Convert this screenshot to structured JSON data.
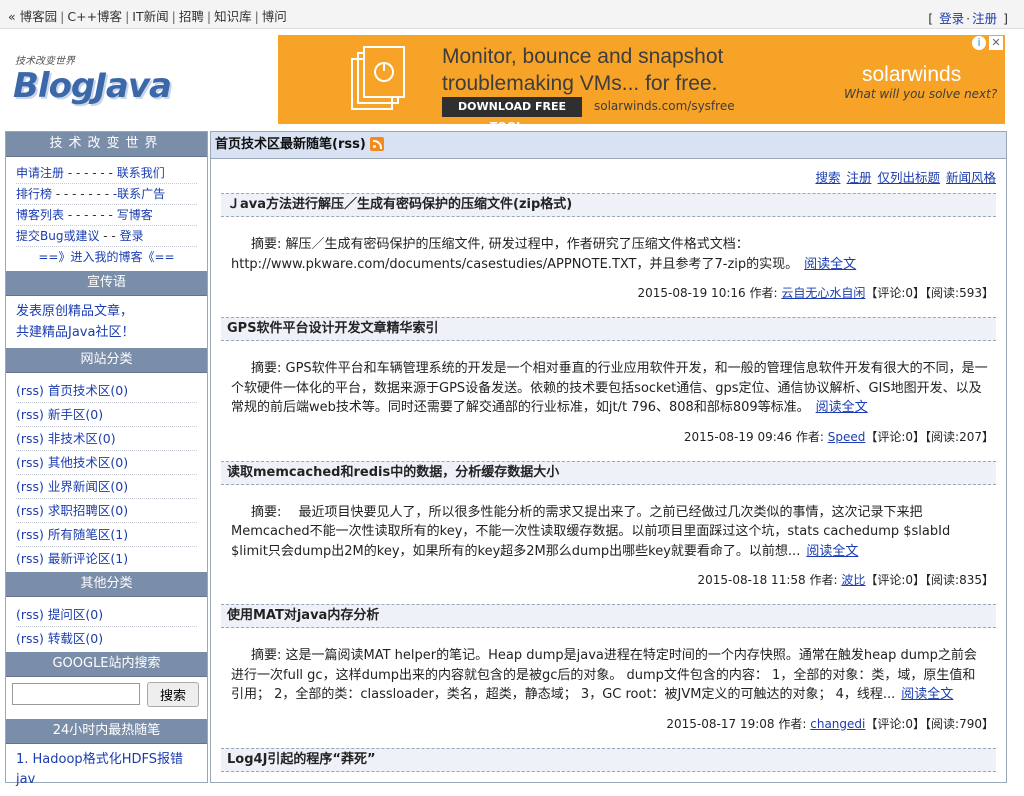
{
  "topbar": {
    "prefix": "«",
    "links": [
      "博客园",
      "C++博客",
      "IT新闻",
      "招聘",
      "知识库",
      "博问"
    ],
    "bracket_open": "[",
    "bracket_close": "]",
    "login": "登录",
    "dot": "·",
    "register": "注册"
  },
  "header": {
    "slogan": "技术改变世界",
    "logo": "BlogJava"
  },
  "ad": {
    "headline_1": "Monitor, bounce and snapshot",
    "headline_2": "troublemaking VMs... for free.",
    "cta": "DOWNLOAD FREE TOOL »",
    "url": "solarwinds.com/sysfree",
    "brand": "solarwinds",
    "tagline": "What will you solve next?",
    "close": "✕",
    "info": "i"
  },
  "sidebar": {
    "title": "技术改变世界",
    "links": [
      {
        "a": "申请注册",
        "sep": " - - - - - - ",
        "b": "联系我们"
      },
      {
        "a": "排行榜",
        "sep": " - - - - - - - ",
        "b": "-联系广告"
      },
      {
        "a": "博客列表",
        "sep": " - - - - - - ",
        "b": "写博客"
      },
      {
        "a": "提交Bug或建议",
        "sep": " - - ",
        "b": "登录"
      }
    ],
    "enter_blog": "==》进入我的博客《==",
    "promo_title": "宣传语",
    "promo_1": "发表原创精品文章，",
    "promo_2": "共建精品Java社区！",
    "cat_title": "网站分类",
    "categories": [
      "(rss) 首页技术区(0)",
      "(rss) 新手区(0)",
      "(rss) 非技术区(0)",
      "(rss) 其他技术区(0)",
      "(rss) 业界新闻区(0)",
      "(rss) 求职招聘区(0)",
      "(rss) 所有随笔区(1)",
      "(rss) 最新评论区(1)"
    ],
    "other_title": "其他分类",
    "other": [
      "(rss) 提问区(0)",
      "(rss) 转载区(0)"
    ],
    "search_title": "GOOGLE站内搜索",
    "search_button": "搜索",
    "hot_title": "24小时内最热随笔",
    "hot_1": "1. Hadoop格式化HDFS报错jav"
  },
  "main": {
    "title": "首页技术区最新随笔(rss)",
    "links": [
      "搜索",
      "注册",
      "仅列出标题",
      "新闻风格"
    ],
    "read_more": "阅读全文",
    "author_label": "作者:",
    "posts": [
      {
        "title": "Ｊava方法进行解压／生成有密码保护的压缩文件(zip格式)",
        "summary": "摘要: 解压／生成有密码保护的压缩文件, 研发过程中，作者研究了压缩文件格式文档： http://www.pkware.com/documents/casestudies/APPNOTE.TXT，并且参考了7-zip的实现。",
        "date": "2015-08-19 10:16",
        "author": "云自无心水自闲",
        "stats": "【评论:0】【阅读:593】"
      },
      {
        "title": "GPS软件平台设计开发文章精华索引",
        "summary": "摘要: GPS软件平台和车辆管理系统的开发是一个相对垂直的行业应用软件开发，和一般的管理信息软件开发有很大的不同，是一个软硬件一体化的平台，数据来源于GPS设备发送。依赖的技术要包括socket通信、gps定位、通信协议解析、GIS地图开发、以及常规的前后端web技术等。同时还需要了解交通部的行业标准，如jt/t 796、808和部标809等标准。",
        "date": "2015-08-19 09:46",
        "author": "Speed",
        "stats": "【评论:0】【阅读:207】"
      },
      {
        "title": "读取memcached和redis中的数据，分析缓存数据大小",
        "summary": "摘要:　 最近项目快要见人了，所以很多性能分析的需求又提出来了。之前已经做过几次类似的事情，这次记录下来把Memcached不能一次性读取所有的key，不能一次性读取缓存数据。以前项目里面踩过这个坑，stats cachedump $slabId $limit只会dump出2M的key，如果所有的key超多2M那么dump出哪些key就要看命了。以前想...",
        "date": "2015-08-18 11:58",
        "author": "波比",
        "stats": "【评论:0】【阅读:835】"
      },
      {
        "title": "使用MAT对java内存分析",
        "summary": "摘要: 这是一篇阅读MAT helper的笔记。Heap dump是java进程在特定时间的一个内存快照。通常在触发heap dump之前会进行一次full gc，这样dump出来的内容就包含的是被gc后的对象。 dump文件包含的内容： 1，全部的对象：类，域，原生值和引用； 2，全部的类：classloader，类名，超类，静态域； 3，GC root：被JVM定义的可触达的对象； 4，线程...",
        "date": "2015-08-17 19:08",
        "author": "changedi",
        "stats": "【评论:0】【阅读:790】"
      },
      {
        "title": "Log4J引起的程序“莽死”",
        "summary": "",
        "date": "",
        "author": "",
        "stats": ""
      }
    ]
  }
}
